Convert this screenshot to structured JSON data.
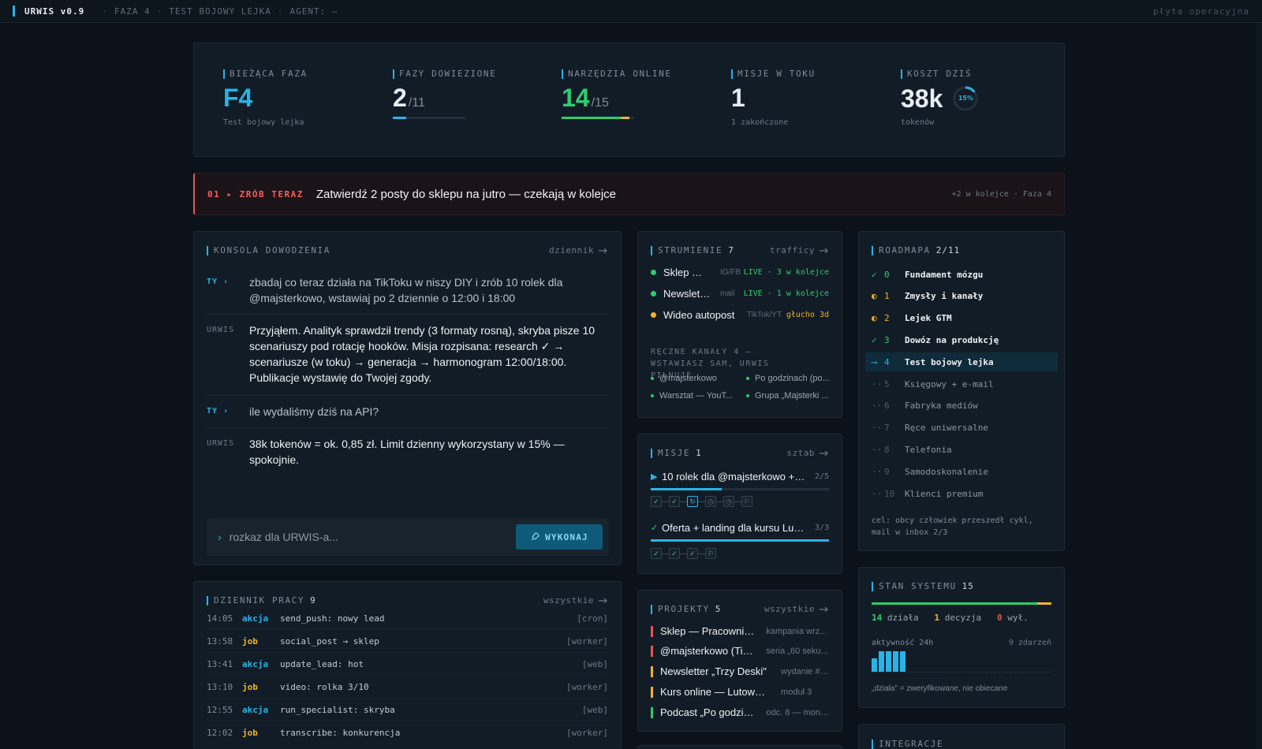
{
  "topbar": {
    "brand": "URWIS v0.9",
    "phase": "FAZA 4",
    "test": "TEST BOJOWY LEJKA",
    "agent": "AGENT: —",
    "right": "płyta operacyjna"
  },
  "kpis": {
    "phase": {
      "label": "BIEŻĄCA FAZA",
      "value": "F4",
      "sub": "Test bojowy lejka"
    },
    "done": {
      "label": "FAZY DOWIEZIONE",
      "value": "2",
      "of": "/11",
      "progress": 0.18
    },
    "tools": {
      "label": "NARZĘDZIA ONLINE",
      "value": "14",
      "of": "/15",
      "progress": 0.93
    },
    "missions": {
      "label": "MISJE W TOKU",
      "value": "1",
      "sub": "1 zakończone"
    },
    "cost": {
      "label": "KOSZT DZIŚ",
      "value": "38k",
      "sub": "tokenów",
      "ring": "15%",
      "ring_fraction": 0.15
    }
  },
  "alert": {
    "tag": "01 ▸ ZRÓB TERAZ",
    "message": "Zatwierdź 2 posty do sklepu na jutro — czekają w kolejce",
    "meta": "+2 w kolejce · Faza 4"
  },
  "console": {
    "title": "KONSOLA DOWODZENIA",
    "link": "dziennik",
    "messages": [
      {
        "who": "TY ›",
        "text": "zbadaj co teraz działa na TikToku w niszy DIY i zrób 10 rolek dla @majsterkowo, wstawiaj po 2 dziennie o 12:00 i 18:00"
      },
      {
        "who": "URWIS",
        "text": "Przyjąłem. Analityk sprawdził trendy (3 formaty rosną), skryba pisze 10 scenariuszy pod rotację hooków. Misja rozpisana: research ✓ → scenariusze (w toku) → generacja → harmonogram 12:00/18:00. Publikacje wystawię do Twojej zgody."
      },
      {
        "who": "TY ›",
        "text": "ile wydaliśmy dziś na API?"
      },
      {
        "who": "URWIS",
        "text": "38k tokenów = ok. 0,85 zł. Limit dzienny wykorzystany w 15% — spokojnie."
      }
    ],
    "input_placeholder": "rozkaz dla URWIS-a...",
    "button": "WYKONAJ"
  },
  "log": {
    "title": "DZIENNIK PRACY",
    "count": "9",
    "link": "wszystkie",
    "rows": [
      {
        "time": "14:05",
        "kind": "akcja",
        "msg": "send_push: nowy lead",
        "src": "[cron]"
      },
      {
        "time": "13:58",
        "kind": "job",
        "msg": "social_post → sklep",
        "src": "[worker]"
      },
      {
        "time": "13:41",
        "kind": "akcja",
        "msg": "update_lead: hot",
        "src": "[web]"
      },
      {
        "time": "13:10",
        "kind": "job",
        "msg": "video: rolka 3/10",
        "src": "[worker]"
      },
      {
        "time": "12:55",
        "kind": "akcja",
        "msg": "run_specialist: skryba",
        "src": "[web]"
      },
      {
        "time": "12:02",
        "kind": "job",
        "msg": "transcribe: konkurencja",
        "src": "[worker]"
      }
    ]
  },
  "stream": {
    "title": "STRUMIENIE",
    "count": "7",
    "link": "trafficy",
    "rows": [
      {
        "name": "Sklep — p...",
        "channel": "IG/FB",
        "status": "LIVE · 3 w kolejce",
        "color": "#2ecc71"
      },
      {
        "name": "Newslette...",
        "channel": "mail",
        "status": "LIVE · 1 w kolejce",
        "color": "#2ecc71"
      },
      {
        "name": "Wideo autopost",
        "channel": "TikTok/YT",
        "status": "głucho 3d",
        "color": "#f0b429"
      }
    ],
    "manual_header": "RĘCZNE KANAŁY 4 — WSTAWIASZ SAM, URWIS PILNUJE",
    "manual": [
      "@majsterkowo",
      "Po godzinach (po...",
      "Warsztat — YouT...",
      "Grupa „Majsterki ..."
    ]
  },
  "missions": {
    "title": "MISJE",
    "count": "1",
    "link": "sztab",
    "items": [
      {
        "name": "10 rolek dla @majsterkowo + har...",
        "count": "2/5",
        "progress": 0.4
      },
      {
        "name": "Oferta + landing dla kursu Lutow...",
        "count": "3/3",
        "progress": 1.0
      }
    ]
  },
  "projects": {
    "title": "PROJEKTY",
    "count": "5",
    "link": "wszystkie",
    "rows": [
      {
        "name": "Sklep — Pracownia L...",
        "desc": "kampania wrz...",
        "color": "#e05656"
      },
      {
        "name": "@majsterkowo (TikT...",
        "desc": "seria „60 seku...",
        "color": "#e05656"
      },
      {
        "name": "Newsletter „Trzy Deski\"",
        "desc": "wydanie #12",
        "color": "#f0b429"
      },
      {
        "name": "Kurs online — Lutowanie",
        "desc": "moduł 3",
        "color": "#f0b429"
      },
      {
        "name": "Podcast „Po godzina...",
        "desc": "odc. 8 — mont...",
        "color": "#2ecc71"
      }
    ]
  },
  "roadmap": {
    "title": "ROADMAPA",
    "count": "2/11",
    "items": [
      {
        "icon": "✓",
        "n": "0",
        "label": "Fundament mózgu",
        "state": "done"
      },
      {
        "icon": "◐",
        "n": "1",
        "label": "Zmysły i kanały",
        "state": "half"
      },
      {
        "icon": "◐",
        "n": "2",
        "label": "Lejek GTM",
        "state": "half"
      },
      {
        "icon": "✓",
        "n": "3",
        "label": "Dowóz na produkcję",
        "state": "done"
      },
      {
        "icon": "⟶",
        "n": "4",
        "label": "Test bojowy lejka",
        "state": "cur"
      },
      {
        "icon": "··",
        "n": "5",
        "label": "Księgowy + e-mail",
        "state": "todo"
      },
      {
        "icon": "··",
        "n": "6",
        "label": "Fabryka mediów",
        "state": "todo"
      },
      {
        "icon": "··",
        "n": "7",
        "label": "Ręce uniwersalne",
        "state": "todo"
      },
      {
        "icon": "··",
        "n": "8",
        "label": "Telefonia",
        "state": "todo"
      },
      {
        "icon": "··",
        "n": "9",
        "label": "Samodoskonalenie",
        "state": "todo"
      },
      {
        "icon": "··",
        "n": "10",
        "label": "Klienci premium",
        "state": "todo"
      }
    ],
    "goal": "cel: obcy człowiek przeszedł cykl, mail w inbox 2/3"
  },
  "system": {
    "title": "STAN SYSTEMU",
    "count": "15",
    "ok": "14",
    "ok_label": "działa",
    "dec": "1",
    "dec_label": "decyzja",
    "off": "0",
    "off_label": "wył.",
    "activity_label": "aktywność 24h",
    "events": "9 zdarzeń",
    "activity": [
      2,
      3,
      3,
      3,
      3
    ],
    "note": "„działa\" = zweryfikowane, nie obiecane"
  },
  "integrations": {
    "title": "INTEGRACJE"
  },
  "colors": {
    "accent": "#2ab3e6",
    "ok": "#2ecc71",
    "warn": "#f0b429",
    "danger": "#e05656"
  }
}
